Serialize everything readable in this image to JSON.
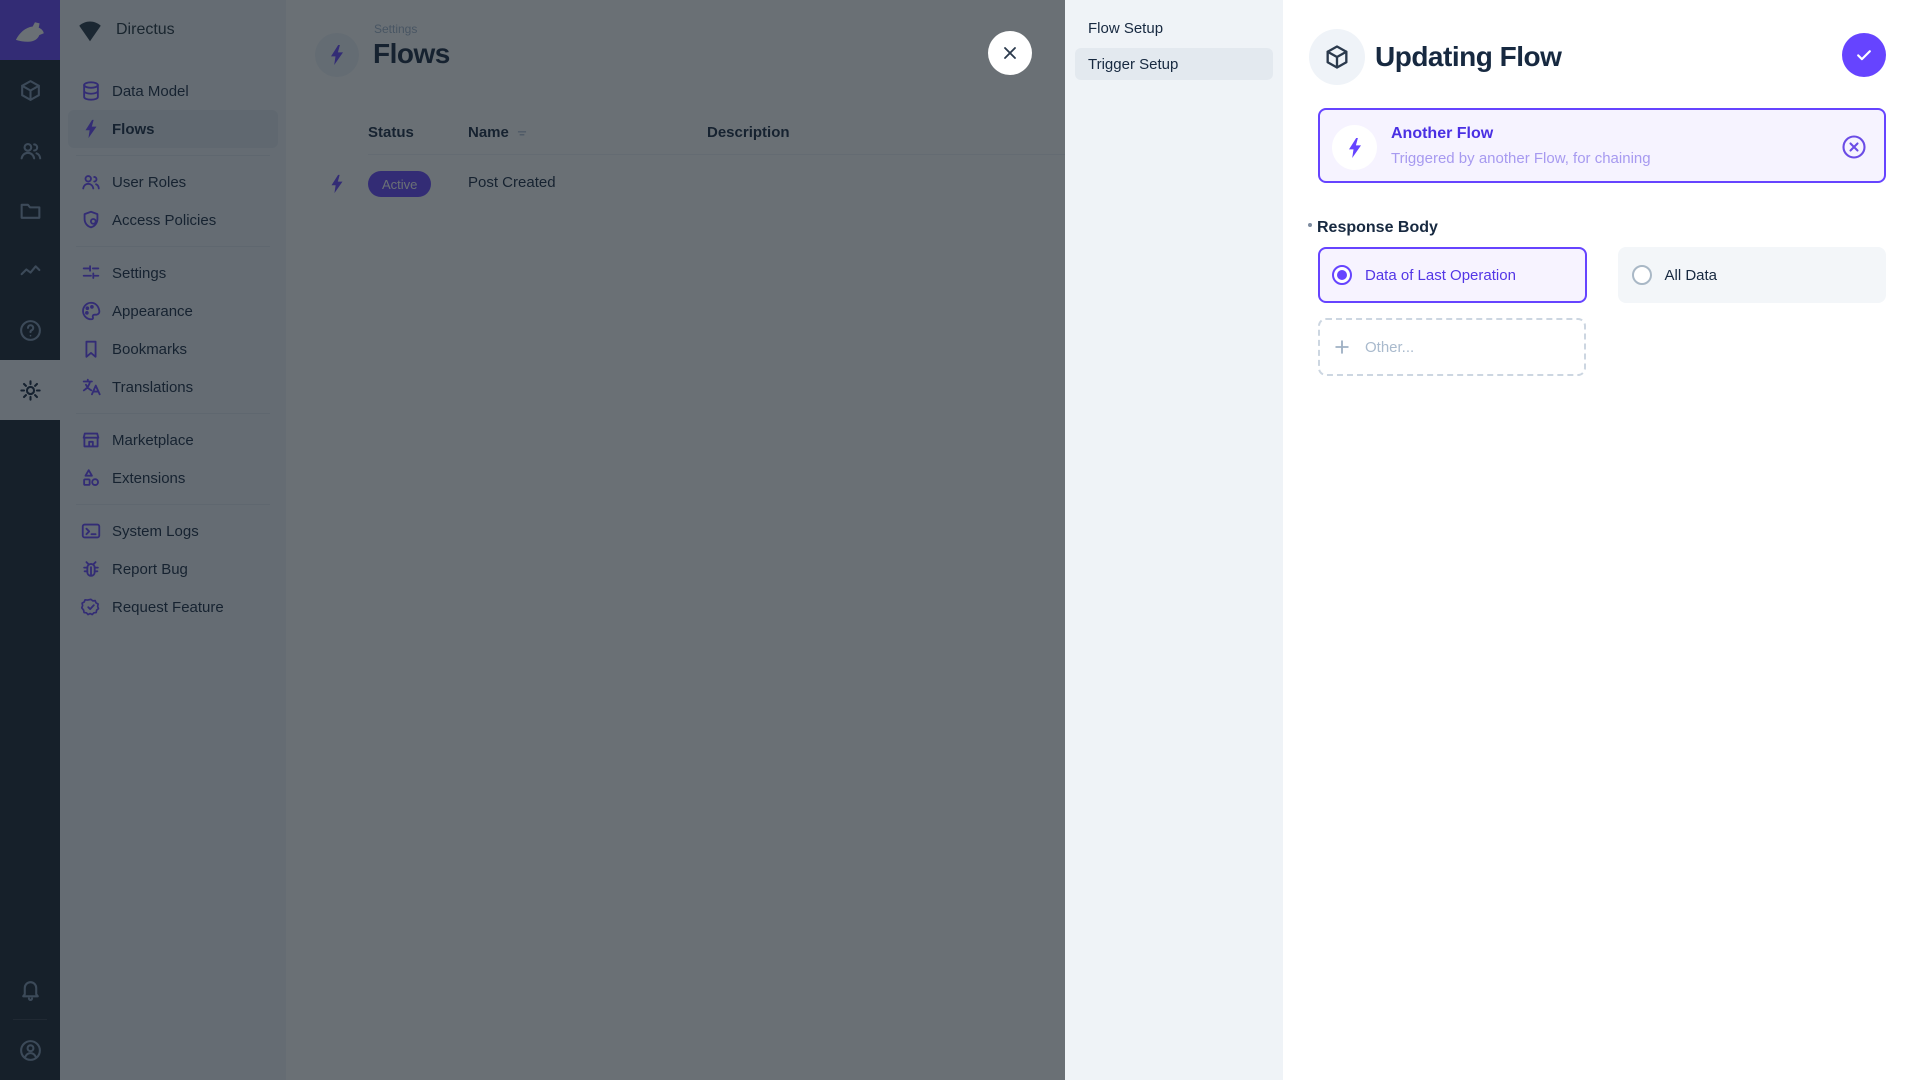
{
  "colors": {
    "accent": "#6644ff",
    "fg": "#172940",
    "subdued": "#a2b5cd",
    "sidebar-bg": "#f0f4f9",
    "module-bg": "#18222f",
    "module-icon": "#8196b1"
  },
  "module_bar": {
    "modules": [
      {
        "icon": "content-cube",
        "active": false
      },
      {
        "icon": "users",
        "active": false
      },
      {
        "icon": "files-folder",
        "active": false
      },
      {
        "icon": "insights-activity",
        "active": false
      },
      {
        "icon": "help-circle",
        "active": false
      },
      {
        "icon": "settings-gear",
        "active": true
      }
    ],
    "bottom": [
      {
        "icon": "notifications-bell"
      },
      {
        "icon": "user-avatar"
      }
    ]
  },
  "sidebar": {
    "project_name": "Directus",
    "items": [
      {
        "label": "Data Model",
        "icon": "database"
      },
      {
        "label": "Flows",
        "icon": "bolt",
        "active": true
      },
      {
        "divider": true
      },
      {
        "label": "User Roles",
        "icon": "people"
      },
      {
        "label": "Access Policies",
        "icon": "shield-lock"
      },
      {
        "divider": true
      },
      {
        "label": "Settings",
        "icon": "tune-sliders"
      },
      {
        "label": "Appearance",
        "icon": "palette"
      },
      {
        "label": "Bookmarks",
        "icon": "bookmark"
      },
      {
        "label": "Translations",
        "icon": "translate"
      },
      {
        "divider": true
      },
      {
        "label": "Marketplace",
        "icon": "storefront"
      },
      {
        "label": "Extensions",
        "icon": "shapes"
      },
      {
        "divider": true
      },
      {
        "label": "System Logs",
        "icon": "terminal"
      },
      {
        "label": "Report Bug",
        "icon": "bug"
      },
      {
        "label": "Request Feature",
        "icon": "badge-check"
      }
    ]
  },
  "main": {
    "breadcrumb": "Settings",
    "title": "Flows",
    "table": {
      "headers": [
        "Status",
        "Name",
        "Description"
      ],
      "rows": [
        {
          "status": "Active",
          "name": "Post Created",
          "description": ""
        }
      ]
    }
  },
  "drawer": {
    "steps": [
      {
        "label": "Flow Setup",
        "active": false
      },
      {
        "label": "Trigger Setup",
        "active": true
      }
    ],
    "title": "Updating Flow",
    "trigger_card": {
      "title": "Another Flow",
      "subtitle": "Triggered by another Flow, for chaining"
    },
    "field": {
      "label": "Response Body",
      "required": true
    },
    "options": [
      {
        "label": "Data of Last Operation",
        "selected": true
      },
      {
        "label": "All Data",
        "selected": false
      }
    ],
    "other_label": "Other..."
  }
}
